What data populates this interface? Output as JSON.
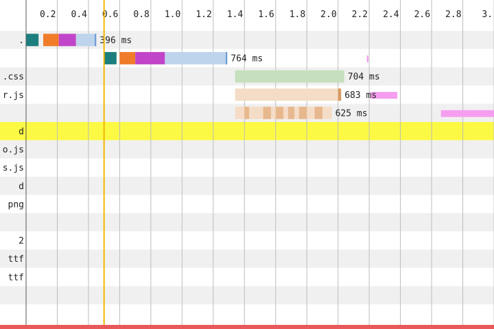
{
  "chart_data": {
    "type": "waterfall",
    "x_unit": "s",
    "xlim": [
      0,
      3.0
    ],
    "ticks": [
      0.2,
      0.4,
      0.6,
      0.8,
      1.0,
      1.2,
      1.4,
      1.6,
      1.8,
      2.0,
      2.2,
      2.4,
      2.6,
      2.8,
      3.0
    ],
    "tick_labels": [
      "0.2",
      "0.4",
      "0.6",
      "0.8",
      "1.0",
      "1.2",
      "1.4",
      "1.6",
      "1.8",
      "2.0",
      "2.2",
      "2.4",
      "2.6",
      "2.8",
      "3."
    ],
    "markers": [
      {
        "x": 0.5,
        "color": "#f5b700"
      }
    ],
    "rows": [
      {
        "label": ".",
        "highlight": false,
        "duration_label": "396 ms",
        "segments": [
          {
            "kind": "dns",
            "start": 0.0,
            "end": 0.08,
            "color": "#1d7f7d"
          },
          {
            "kind": "connect",
            "start": 0.11,
            "end": 0.21,
            "color": "#f07c2a"
          },
          {
            "kind": "ssl",
            "start": 0.21,
            "end": 0.32,
            "color": "#c145c8"
          },
          {
            "kind": "wait",
            "start": 0.32,
            "end": 0.44,
            "color": "#bed3ec"
          },
          {
            "kind": "receive",
            "start": 0.44,
            "end": 0.45,
            "color": "#6d9dd4"
          }
        ],
        "extras": []
      },
      {
        "label": "",
        "highlight": false,
        "duration_label": "764 ms",
        "segments": [
          {
            "kind": "dns",
            "start": 0.5,
            "end": 0.58,
            "color": "#1d7f7d"
          },
          {
            "kind": "connect",
            "start": 0.6,
            "end": 0.7,
            "color": "#f07c2a"
          },
          {
            "kind": "ssl",
            "start": 0.7,
            "end": 0.89,
            "color": "#c145c8"
          },
          {
            "kind": "wait",
            "start": 0.89,
            "end": 1.28,
            "color": "#bed3ec"
          },
          {
            "kind": "receive",
            "start": 1.28,
            "end": 1.29,
            "color": "#6d9dd4"
          }
        ],
        "extras": [
          {
            "start": 2.185,
            "end": 2.195,
            "color": "#f59ef0"
          }
        ]
      },
      {
        "label": ".css",
        "highlight": false,
        "duration_label": "704 ms",
        "segments": [
          {
            "kind": "wait",
            "start": 1.34,
            "end": 2.04,
            "color": "#c6dfbe"
          }
        ],
        "extras": []
      },
      {
        "label": "r.js",
        "highlight": false,
        "duration_label": "683 ms",
        "segments": [
          {
            "kind": "wait",
            "start": 1.34,
            "end": 2.0,
            "color": "#f5dcc6"
          },
          {
            "kind": "receive",
            "start": 2.0,
            "end": 2.02,
            "color": "#d89a63"
          }
        ],
        "extras": [
          {
            "start": 2.21,
            "end": 2.38,
            "color": "#f59ef0"
          }
        ]
      },
      {
        "label": "",
        "highlight": false,
        "duration_label": "625 ms",
        "segments": [
          {
            "kind": "wait",
            "start": 1.34,
            "end": 1.96,
            "color": "#f5dcc6"
          },
          {
            "kind": "receive",
            "start": 1.4,
            "end": 1.43,
            "color": "#e7b88e"
          },
          {
            "kind": "receive",
            "start": 1.52,
            "end": 1.57,
            "color": "#e7b88e"
          },
          {
            "kind": "receive",
            "start": 1.6,
            "end": 1.65,
            "color": "#e7b88e"
          },
          {
            "kind": "receive",
            "start": 1.68,
            "end": 1.72,
            "color": "#e7b88e"
          },
          {
            "kind": "receive",
            "start": 1.75,
            "end": 1.8,
            "color": "#e7b88e"
          },
          {
            "kind": "receive",
            "start": 1.85,
            "end": 1.9,
            "color": "#e7b88e"
          }
        ],
        "extras": [
          {
            "start": 2.66,
            "end": 3.0,
            "color": "#f59ef0"
          }
        ]
      },
      {
        "label": "d",
        "highlight": true,
        "duration_label": "",
        "segments": [],
        "extras": []
      },
      {
        "label": "o.js",
        "highlight": false,
        "duration_label": "",
        "segments": [],
        "extras": []
      },
      {
        "label": "s.js",
        "highlight": false,
        "duration_label": "",
        "segments": [],
        "extras": []
      },
      {
        "label": "d",
        "highlight": false,
        "duration_label": "",
        "segments": [],
        "extras": []
      },
      {
        "label": "png",
        "highlight": false,
        "duration_label": "",
        "segments": [],
        "extras": []
      },
      {
        "label": "",
        "highlight": false,
        "duration_label": "",
        "segments": [],
        "extras": []
      },
      {
        "label": "2",
        "highlight": false,
        "duration_label": "",
        "segments": [],
        "extras": []
      },
      {
        "label": "ttf",
        "highlight": false,
        "duration_label": "",
        "segments": [],
        "extras": []
      },
      {
        "label": "ttf",
        "highlight": false,
        "duration_label": "",
        "segments": [],
        "extras": []
      },
      {
        "label": "",
        "highlight": false,
        "duration_label": "",
        "segments": [],
        "extras": []
      },
      {
        "label": "",
        "highlight": false,
        "duration_label": "",
        "segments": [],
        "extras": []
      }
    ],
    "colors": {
      "row_alt": "#f0f0f0",
      "highlight": "#fbf943",
      "gridline": "#bdbdbd",
      "bottom_bar": "#e85a5a"
    }
  }
}
